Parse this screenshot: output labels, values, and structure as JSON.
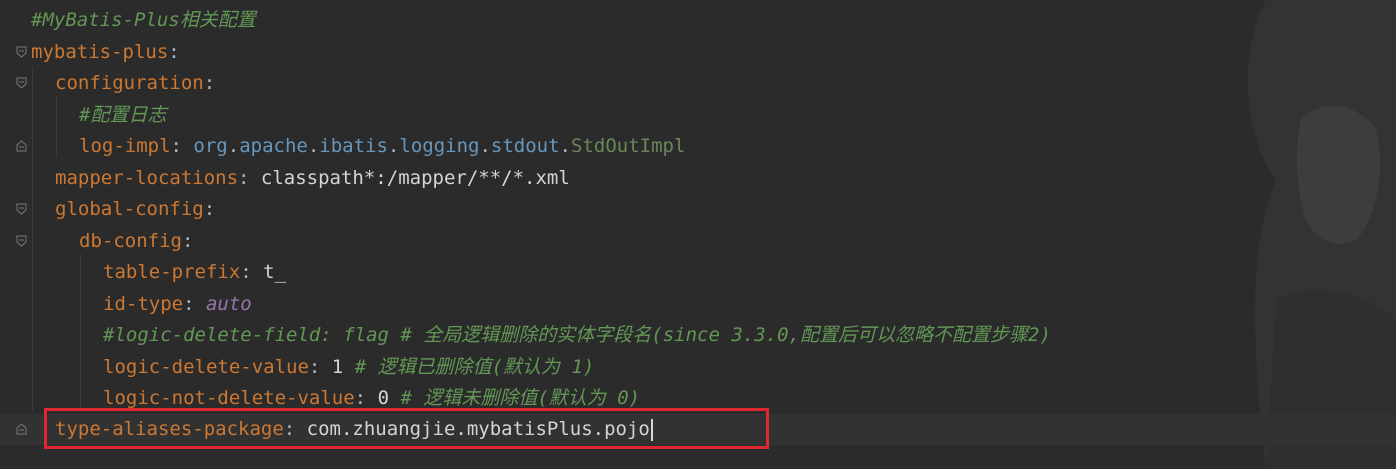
{
  "editor": {
    "language": "yaml",
    "lines": [
      {
        "comment": "#MyBatis-Plus相关配置"
      },
      {
        "key": "mybatis-plus",
        "colon": ":"
      },
      {
        "key": "configuration",
        "colon": ":"
      },
      {
        "comment": "#配置日志"
      },
      {
        "key": "log-impl",
        "colon": ": ",
        "value_parts": [
          "org",
          ".",
          "apache",
          ".",
          "ibatis",
          ".",
          "logging",
          ".",
          "stdout",
          ".",
          "StdOutImpl"
        ]
      },
      {
        "key": "mapper-locations",
        "colon": ": ",
        "value": "classpath*:/mapper/**/*.xml"
      },
      {
        "key": "global-config",
        "colon": ":"
      },
      {
        "key": "db-config",
        "colon": ":"
      },
      {
        "key": "table-prefix",
        "colon": ": ",
        "value": "t_"
      },
      {
        "key": "id-type",
        "colon": ": ",
        "value": "auto"
      },
      {
        "comment": "#logic-delete-field: flag # 全局逻辑删除的实体字段名(since 3.3.0,配置后可以忽略不配置步骤2)"
      },
      {
        "key": "logic-delete-value",
        "colon": ": ",
        "value": "1",
        "comment": " # 逻辑已删除值(默认为 1)"
      },
      {
        "key": "logic-not-delete-value",
        "colon": ": ",
        "value": "0",
        "comment": " # 逻辑未删除值(默认为 0)"
      },
      {
        "key": "type-aliases-package",
        "colon": ": ",
        "value": "com.zhuangjie.mybatisPlus.pojo"
      }
    ]
  },
  "colors": {
    "background": "#2b2b2b",
    "key": "#cc7832",
    "comment": "#629755",
    "keyword": "#9876aa",
    "text": "#a9b7c6",
    "highlight_border": "#e0262e"
  },
  "icons": {
    "fold_marker": "fold-collapse-icon"
  }
}
